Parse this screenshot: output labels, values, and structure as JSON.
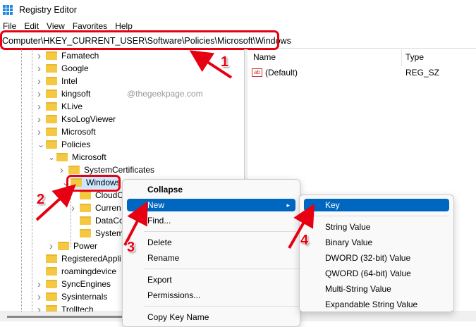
{
  "window": {
    "title": "Registry Editor"
  },
  "menubar": [
    "File",
    "Edit",
    "View",
    "Favorites",
    "Help"
  ],
  "address": "Computer\\HKEY_CURRENT_USER\\Software\\Policies\\Microsoft\\Windows",
  "tree": [
    "Famatech",
    "Google",
    "Intel",
    "kingsoft",
    "KLive",
    "KsoLogViewer",
    "Microsoft",
    "Policies",
    "Microsoft",
    "SystemCertificates",
    "Windows",
    "CloudC",
    "Curren",
    "DataCo",
    "System",
    "Power",
    "RegisteredAppli",
    "roamingdevice",
    "SyncEngines",
    "Sysinternals",
    "Trolltech"
  ],
  "list": {
    "columns": [
      "Name",
      "Type"
    ],
    "rows": [
      {
        "name": "(Default)",
        "type": "REG_SZ",
        "icon": "ab"
      }
    ]
  },
  "watermark": "@thegeekpage.com",
  "context_menu": [
    "Collapse",
    "New",
    "Find...",
    "Delete",
    "Rename",
    "Export",
    "Permissions...",
    "Copy Key Name"
  ],
  "submenu": [
    "Key",
    "String Value",
    "Binary Value",
    "DWORD (32-bit) Value",
    "QWORD (64-bit) Value",
    "Multi-String Value",
    "Expandable String Value"
  ],
  "steps": [
    "1",
    "2",
    "3",
    "4"
  ],
  "colors": {
    "accent": "#0067c0",
    "annotation": "#e60012"
  }
}
